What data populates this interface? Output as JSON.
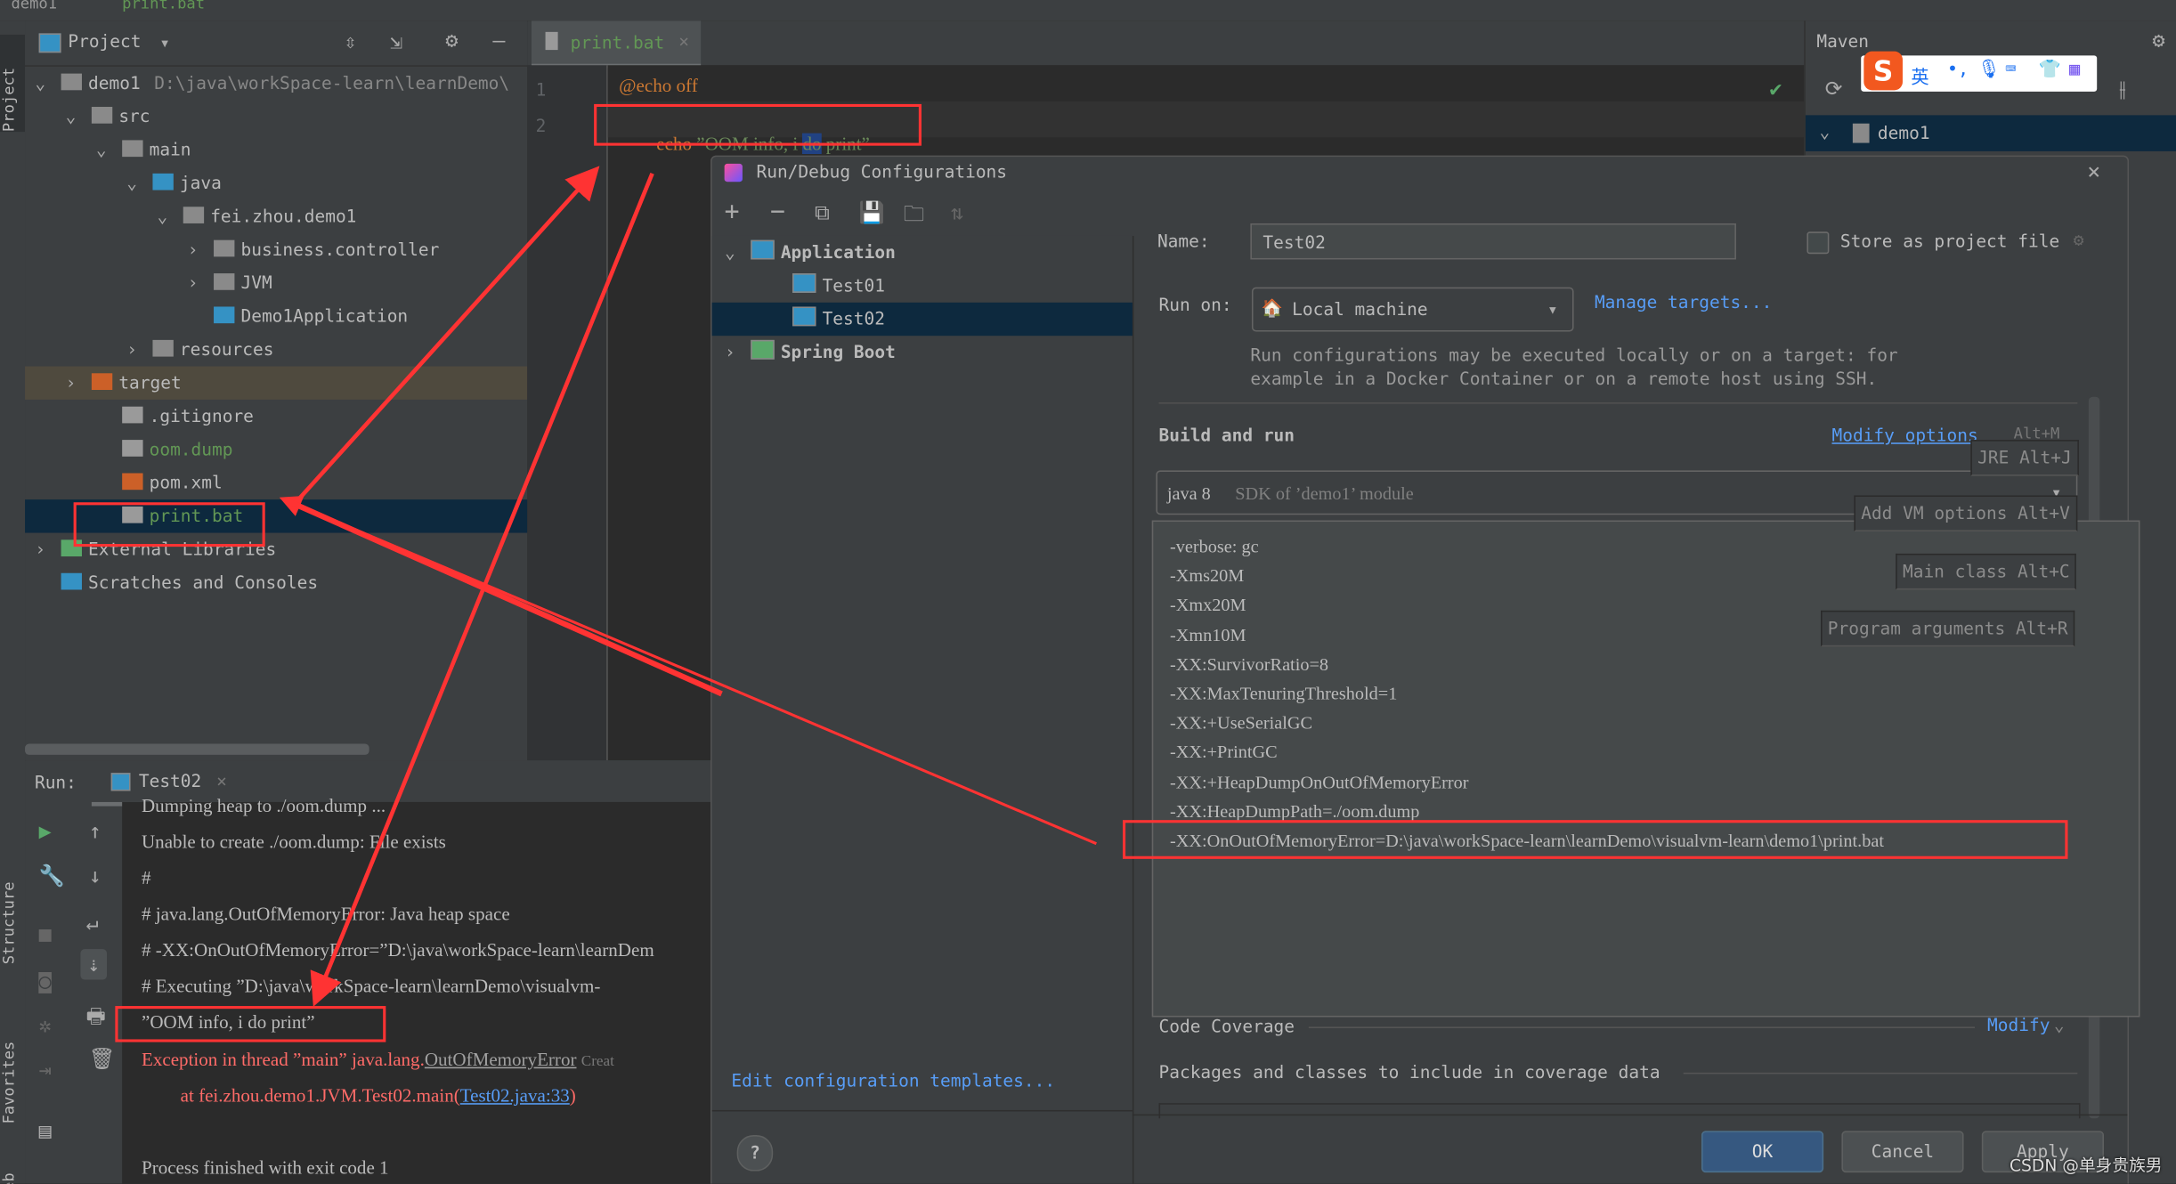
{
  "topbar": {
    "breadcrumb": [
      "demo1",
      "print.bat"
    ]
  },
  "side_tabs": {
    "project": "Project",
    "structure": "Structure",
    "favorites": "Favorites",
    "web": "Web"
  },
  "project_panel": {
    "title": "Project",
    "tree": [
      {
        "label": "demo1",
        "path": "D:\\java\\workSpace-learn\\learnDemo\\",
        "indent": 0,
        "chevron": "down",
        "icon": "module-folder-icon",
        "color": "#bbbbbb"
      },
      {
        "label": "src",
        "indent": 1,
        "chevron": "down",
        "icon": "folder-icon",
        "color": "#bbbbbb"
      },
      {
        "label": "main",
        "indent": 2,
        "chevron": "down",
        "icon": "folder-icon",
        "color": "#bbbbbb"
      },
      {
        "label": "java",
        "indent": 3,
        "chevron": "down",
        "icon": "source-folder-icon",
        "color": "#bbbbbb"
      },
      {
        "label": "fei.zhou.demo1",
        "indent": 4,
        "chevron": "down",
        "icon": "package-icon",
        "color": "#bbbbbb"
      },
      {
        "label": "business.controller",
        "indent": 5,
        "chevron": "right",
        "icon": "package-icon",
        "color": "#bbbbbb"
      },
      {
        "label": "JVM",
        "indent": 5,
        "chevron": "right",
        "icon": "package-icon",
        "color": "#bbbbbb"
      },
      {
        "label": "Demo1Application",
        "indent": 5,
        "chevron": "",
        "icon": "spring-class-icon",
        "color": "#bbbbbb"
      },
      {
        "label": "resources",
        "indent": 3,
        "chevron": "right",
        "icon": "resources-folder-icon",
        "color": "#bbbbbb"
      },
      {
        "label": "target",
        "indent": 1,
        "chevron": "right",
        "icon": "excluded-folder-icon",
        "color": "#bbbbbb",
        "highlight": "target"
      },
      {
        "label": ".gitignore",
        "indent": 2,
        "chevron": "",
        "icon": "ignore-file-icon",
        "color": "#bbbbbb"
      },
      {
        "label": "oom.dump",
        "indent": 2,
        "chevron": "",
        "icon": "unknown-file-icon",
        "color": "#629755"
      },
      {
        "label": "pom.xml",
        "indent": 2,
        "chevron": "",
        "icon": "maven-file-icon",
        "color": "#bbbbbb"
      },
      {
        "label": "print.bat",
        "indent": 2,
        "chevron": "",
        "icon": "text-file-icon",
        "color": "#629755",
        "highlight": "selected"
      },
      {
        "label": "External Libraries",
        "indent": 0,
        "chevron": "right",
        "icon": "libraries-icon",
        "color": "#bbbbbb"
      },
      {
        "label": "Scratches and Consoles",
        "indent": 0,
        "chevron": "",
        "icon": "scratches-icon",
        "color": "#bbbbbb"
      }
    ]
  },
  "editor": {
    "tab": "print.bat",
    "lines": [
      {
        "num": "1",
        "text": "@echo off"
      },
      {
        "num": "2",
        "kw": "echo",
        "str_a": " ”OOM info, i ",
        "sel": "do",
        "str_b": " print”"
      }
    ]
  },
  "maven": {
    "title": "Maven",
    "root": "demo1"
  },
  "run_panel": {
    "label": "Run:",
    "tab": "Test02",
    "console": [
      {
        "text": "Dumping heap to ./oom.dump ...",
        "color": "#bbbbbb"
      },
      {
        "text": "Unable to create ./oom.dump: File exists",
        "color": "#bbbbbb"
      },
      {
        "text": "#",
        "color": "#bbbbbb"
      },
      {
        "text": "# java.lang.OutOfMemoryError: Java heap space",
        "color": "#bbbbbb"
      },
      {
        "text": "# -XX:OnOutOfMemoryError=”D:\\java\\workSpace-learn\\learnDem",
        "color": "#bbbbbb"
      },
      {
        "text": "#   Executing ”D:\\java\\workSpace-learn\\learnDemo\\visualvm-",
        "color": "#bbbbbb"
      },
      {
        "text": "”OOM info, i do print”",
        "color": "#bbbbbb"
      }
    ],
    "exception": {
      "prefix": "Exception in thread ”main” java.lang.",
      "link": "OutOfMemoryError",
      "hint": "Creat"
    },
    "stack": {
      "prefix": "at fei.zhou.demo1.JVM.Test02.main(",
      "link": "Test02.java:33",
      "suffix": ")"
    },
    "finished": "Process finished with exit code 1"
  },
  "dialog": {
    "title": "Run/Debug Configurations",
    "tree": [
      {
        "label": "Application",
        "chevron": "down",
        "indent": 0
      },
      {
        "label": "Test01",
        "chevron": "",
        "indent": 1
      },
      {
        "label": "Test02",
        "chevron": "",
        "indent": 1,
        "selected": true
      },
      {
        "label": "Spring Boot",
        "chevron": "right",
        "indent": 0
      }
    ],
    "edit_templates": "Edit configuration templates...",
    "name_label": "Name:",
    "name_value": "Test02",
    "store_label": "Store as project file",
    "store_checked": false,
    "run_on_label": "Run on:",
    "run_on_value": "Local machine",
    "manage_targets": "Manage targets...",
    "run_on_help": [
      "Run configurations may be executed locally or on a target: for",
      "example in a Docker Container or on a remote host using SSH."
    ],
    "build_and_run": "Build and run",
    "modify_options": "Modify options",
    "modify_shortcut": "Alt+M",
    "jre_value": "java 8",
    "jre_hint": "SDK of ’demo1’ module",
    "hints": {
      "jre": "JRE Alt+J",
      "vm": "Add VM options Alt+V",
      "main": "Main class Alt+C",
      "args": "Program arguments Alt+R"
    },
    "vm_options": [
      "-verbose: gc",
      "-Xms20M",
      "-Xmx20M",
      "-Xmn10M",
      "-XX:SurvivorRatio=8",
      "-XX:MaxTenuringThreshold=1",
      "-XX:+UseSerialGC",
      "-XX:+PrintGC",
      "-XX:+HeapDumpOnOutOfMemoryError",
      "-XX:HeapDumpPath=./oom.dump",
      "-XX:OnOutOfMemoryError=D:\\java\\workSpace-learn\\learnDemo\\visualvm-learn\\demo1\\print.bat"
    ],
    "code_coverage": "Code Coverage",
    "modify": "Modify",
    "packages_label": "Packages and classes to include in coverage data",
    "ok": "OK",
    "cancel": "Cancel",
    "apply": "Apply"
  },
  "watermark": "CSDN @单身贵族男",
  "ime": {
    "mode": "英"
  },
  "colors": {
    "annotation_red": "#ff3333",
    "selection": "#0d293e",
    "link": "#589df6",
    "error": "#ff6b68",
    "ok_button": "#365880"
  }
}
